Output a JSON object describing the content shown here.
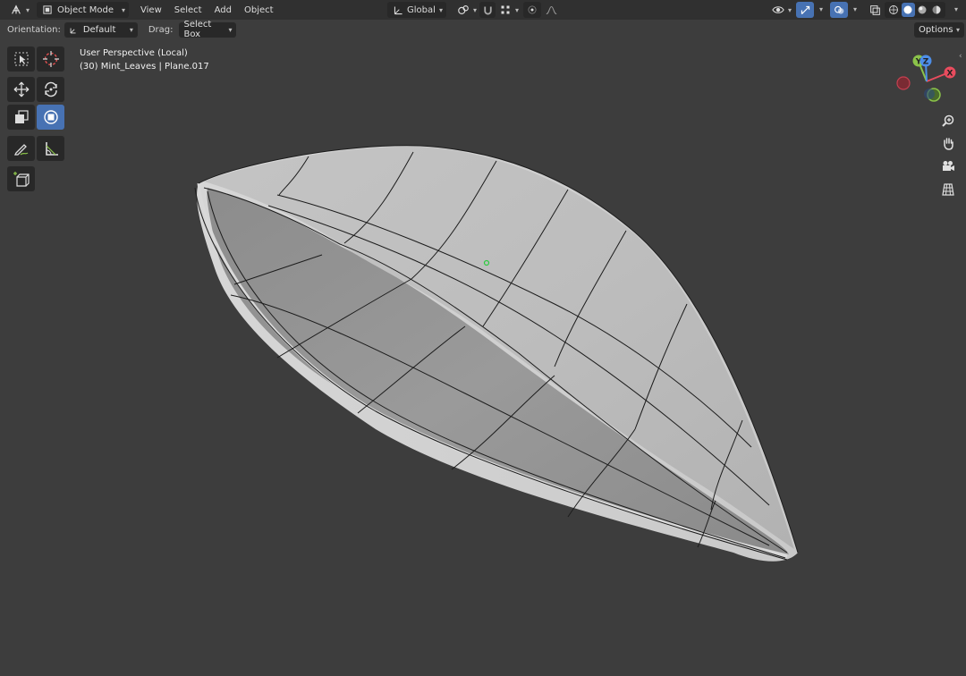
{
  "header": {
    "editor_type_icon": "editor-type-icon",
    "mode": {
      "icon": "object-mode-icon",
      "label": "Object Mode"
    },
    "menus": [
      "View",
      "Select",
      "Add",
      "Object"
    ],
    "transform_orientation": {
      "icon": "transform-orientation-icon",
      "label": "Global"
    },
    "pivot_icon": "pivot-point-icon",
    "snap_icon": "snap-magnet-icon",
    "snap_target_icon": "snap-target-icon",
    "proportional_icon": "proportional-edit-icon",
    "falloff_icon": "falloff-curve-icon",
    "visibility_icon": "visibility-eye-icon",
    "gizmo_icon": "gizmo-icon",
    "overlay_icon": "overlays-icon",
    "xray_icon": "xray-icon",
    "shading_modes": [
      "wireframe",
      "solid",
      "material-preview",
      "rendered"
    ],
    "active_shading": "solid"
  },
  "tool_settings": {
    "orientation_label": "Orientation:",
    "orientation_value": "Default",
    "drag_label": "Drag:",
    "drag_value": "Select Box",
    "options_label": "Options"
  },
  "viewport": {
    "perspective": "User Perspective (Local)",
    "object_info": "(30) Mint_Leaves | Plane.017"
  },
  "tools": [
    {
      "name": "select-box-tool",
      "active": false
    },
    {
      "name": "cursor-tool",
      "active": false
    },
    {
      "name": "move-tool",
      "active": false
    },
    {
      "name": "rotate-tool",
      "active": false
    },
    {
      "name": "scale-tool",
      "active": false
    },
    {
      "name": "transform-tool",
      "active": true
    },
    {
      "name": "annotate-tool",
      "active": false
    },
    {
      "name": "measure-tool",
      "active": false
    },
    {
      "name": "add-cube-tool",
      "active": false
    }
  ],
  "gizmo": {
    "x_label": "X",
    "y_label": "Y",
    "z_label": "Z"
  },
  "navigation": [
    "zoom-icon",
    "pan-hand-icon",
    "camera-icon",
    "grid-ortho-icon"
  ],
  "colors": {
    "header_bg": "#303030",
    "viewport_bg": "#3d3d3d",
    "active_blue": "#4772b3",
    "axis_x": "#e84c5e",
    "axis_y": "#8bc34a",
    "axis_z": "#4d8ee8"
  }
}
